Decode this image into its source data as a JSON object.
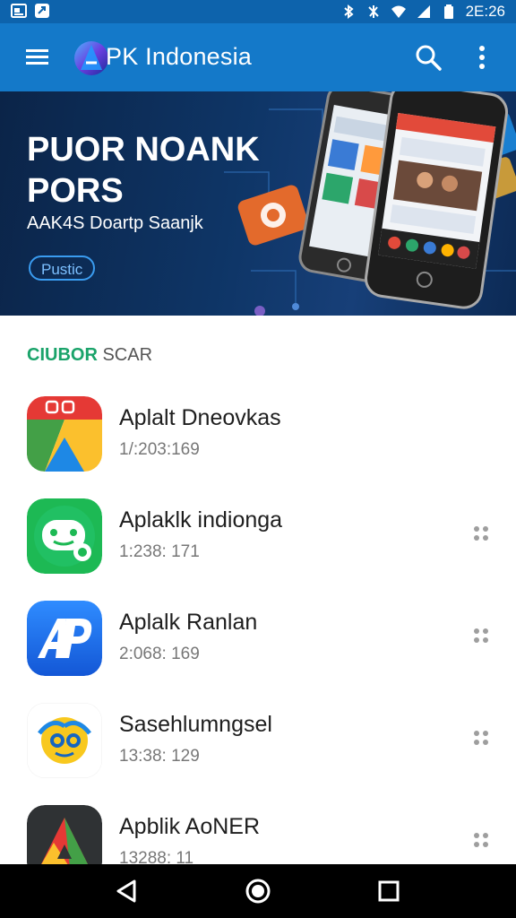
{
  "status_bar": {
    "time": "2E:26",
    "left_icons": [
      "image-icon",
      "sync-icon"
    ],
    "right_icons": [
      "bluetooth-icon",
      "vibrate-icon",
      "wifi-icon",
      "signal-icon",
      "battery-icon"
    ]
  },
  "app_bar": {
    "title": "PK Indonesia",
    "logo_letter": "A",
    "colors": {
      "background": "#1479c9",
      "status": "#0d63ac"
    }
  },
  "banner": {
    "title": "PUOR NOANK\nPORS",
    "subtitle": "AAK4S Doartp Saanjk",
    "chip_label": "Pustic"
  },
  "section": {
    "label_accent": "CIUBOR",
    "label_rest": "SCAR",
    "accent_color": "#1aa36a"
  },
  "apps": [
    {
      "name": "Aplalt Dneovkas",
      "meta": "1/:203:169",
      "icon": "google-style-icon",
      "show_more": false
    },
    {
      "name": "Aplaklk indionga",
      "meta": "1:238: 171",
      "icon": "green-chat-icon",
      "show_more": true
    },
    {
      "name": "Aplalk Ranlan",
      "meta": "2:068: 169",
      "icon": "ap-logo-icon",
      "show_more": true
    },
    {
      "name": "Sasehlumngsel",
      "meta": "13:38: 129",
      "icon": "yellow-face-icon",
      "show_more": true
    },
    {
      "name": "Apblik AoNER",
      "meta": "13288: 11",
      "icon": "triangle-logo-icon",
      "show_more": true
    }
  ],
  "nav_bar": {
    "buttons": [
      "back-icon",
      "home-icon",
      "recents-icon"
    ]
  }
}
